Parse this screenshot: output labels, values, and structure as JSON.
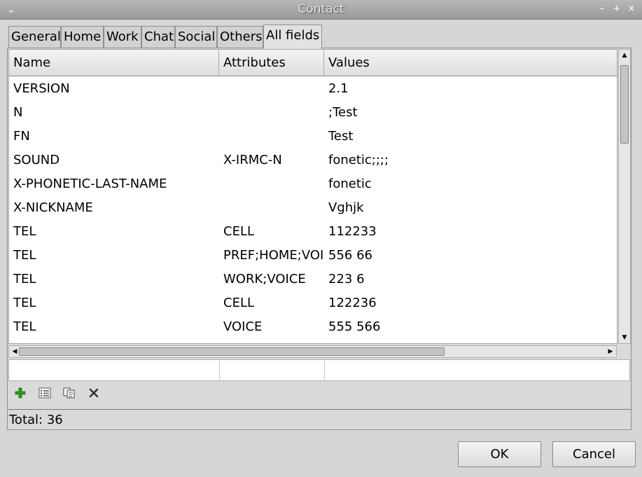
{
  "window": {
    "title": "Contact"
  },
  "tabs": [
    {
      "label": "General"
    },
    {
      "label": "Home"
    },
    {
      "label": "Work"
    },
    {
      "label": "Chat"
    },
    {
      "label": "Social"
    },
    {
      "label": "Others"
    },
    {
      "label": "All fields",
      "active": true
    }
  ],
  "table": {
    "columns": [
      "Name",
      "Attributes",
      "Values"
    ],
    "rows": [
      [
        "VERSION",
        "",
        "2.1"
      ],
      [
        "N",
        "",
        ";Test"
      ],
      [
        "FN",
        "",
        "Test"
      ],
      [
        "SOUND",
        "X-IRMC-N",
        "fonetic;;;;"
      ],
      [
        "X-PHONETIC-LAST-NAME",
        "",
        "fonetic"
      ],
      [
        "X-NICKNAME",
        "",
        "Vghjk"
      ],
      [
        "TEL",
        "CELL",
        "112233"
      ],
      [
        "TEL",
        "PREF;HOME;VOICE",
        "556 66"
      ],
      [
        "TEL",
        "WORK;VOICE",
        "223 6"
      ],
      [
        "TEL",
        "CELL",
        "122236"
      ],
      [
        "TEL",
        "VOICE",
        "555 566"
      ]
    ]
  },
  "toolbar": {
    "add_icon": "plus-icon",
    "edit_icon": "list-icon",
    "copy_icon": "copy-icon",
    "delete_icon": "delete-icon"
  },
  "status": {
    "total": "Total: 36"
  },
  "buttons": {
    "ok": "OK",
    "cancel": "Cancel"
  },
  "colors": {
    "add_green": "#2a9a1a",
    "titlebar": "#a8a8a8"
  }
}
